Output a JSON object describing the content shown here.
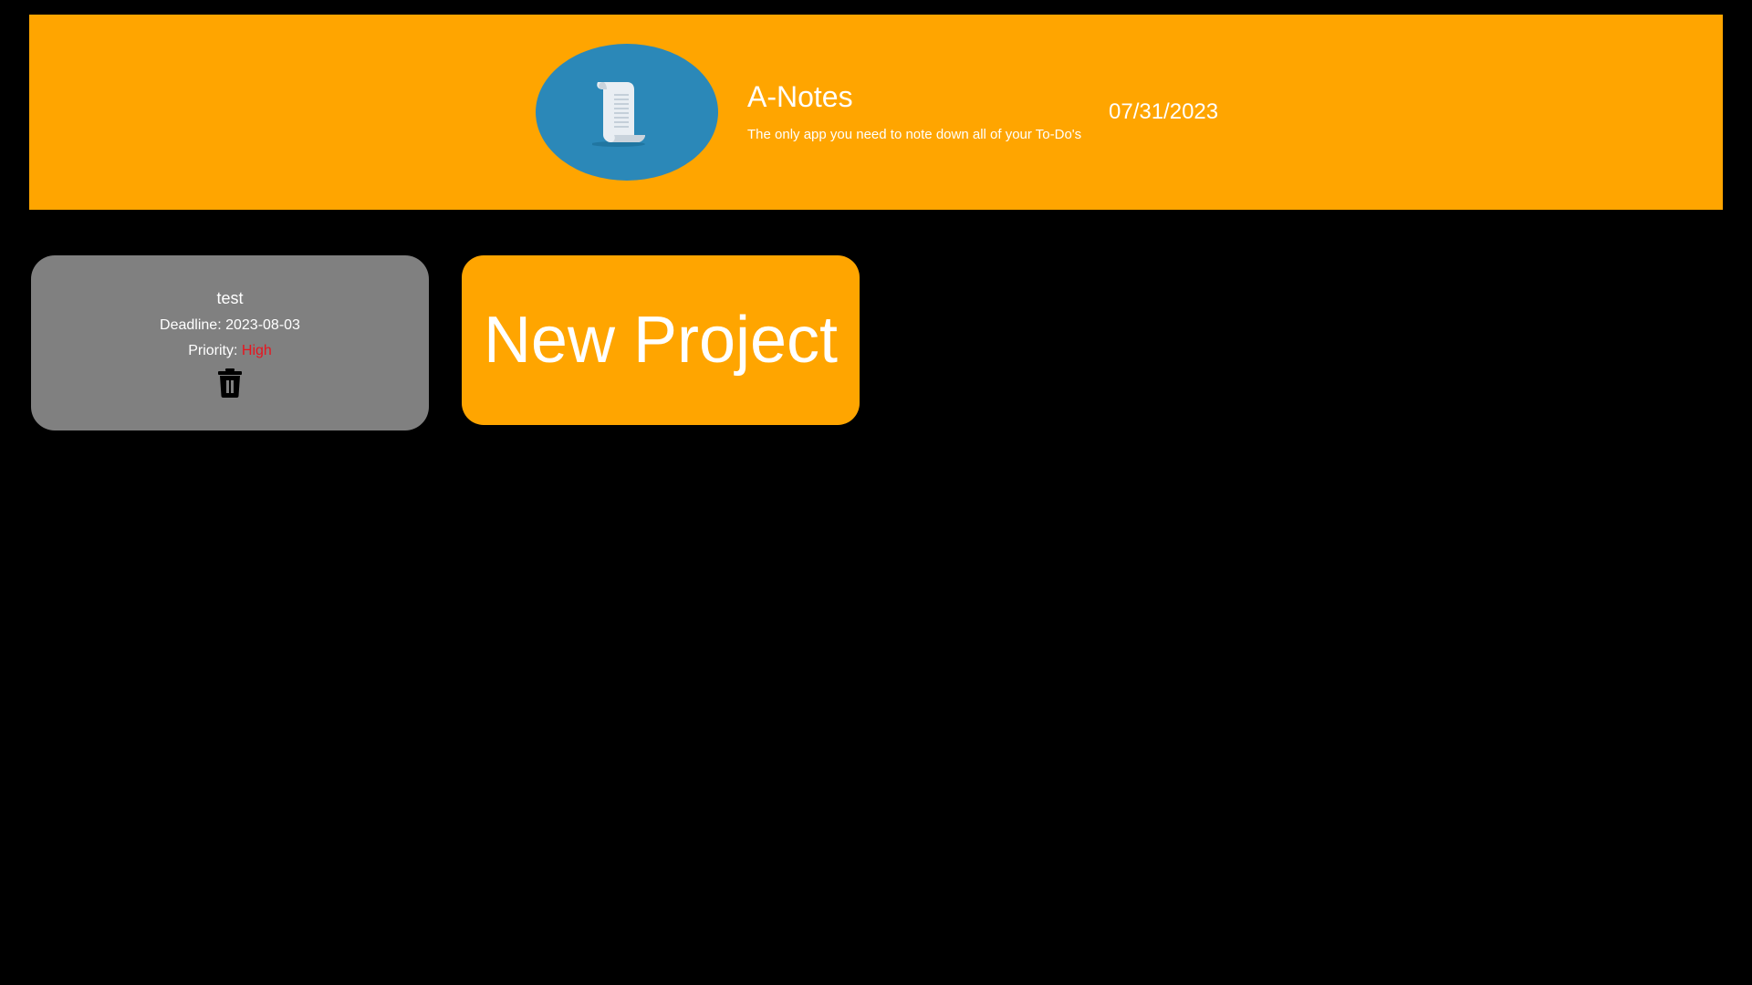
{
  "header": {
    "title": "A-Notes",
    "subtitle": "The only app you need to note down all of your To-Do's",
    "date": "07/31/2023",
    "logo_icon": "scroll-icon",
    "colors": {
      "background": "#FFA500",
      "logo_circle": "#2B88B8"
    }
  },
  "projects": [
    {
      "title": "test",
      "deadline_label": "Deadline:",
      "deadline": "2023-08-03",
      "priority_label": "Priority:",
      "priority": "High",
      "priority_color": "#E8141E",
      "delete_icon": "trash-icon"
    }
  ],
  "new_project": {
    "label": "New Project"
  }
}
